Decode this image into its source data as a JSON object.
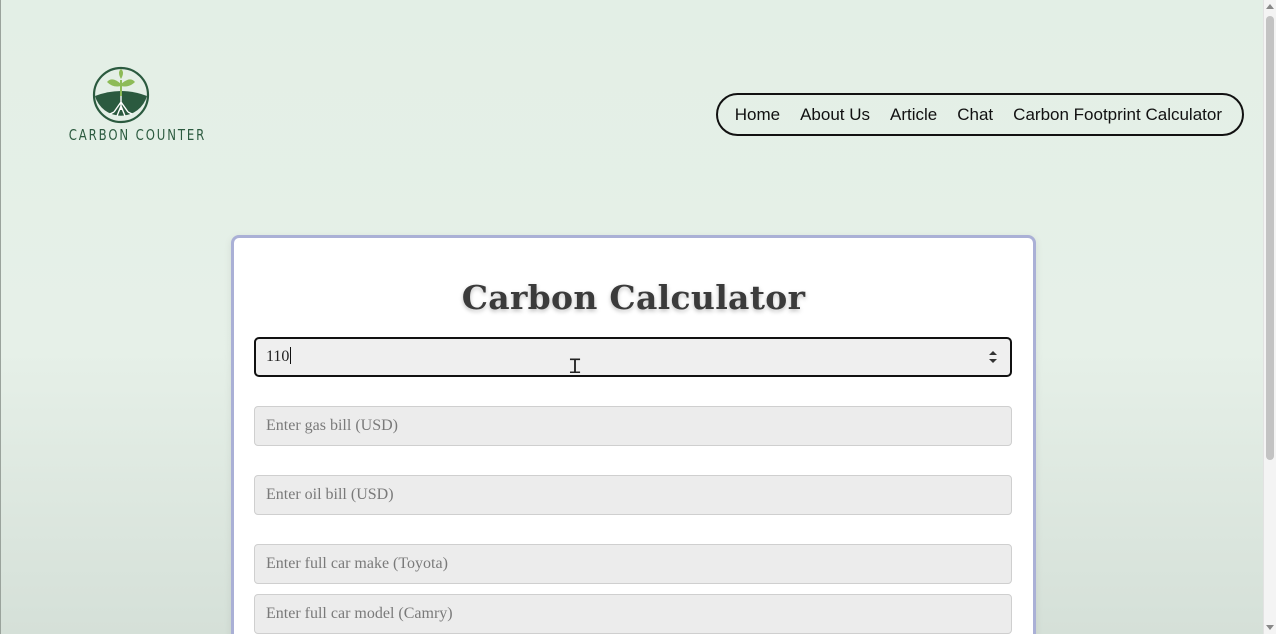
{
  "brand": {
    "logo_text": "CARBON COUNTER",
    "colors": {
      "dark_green": "#2b5a3f",
      "leaf_green": "#8dbb57"
    }
  },
  "nav": {
    "items": [
      "Home",
      "About Us",
      "Article",
      "Chat",
      "Carbon Footprint Calculator"
    ]
  },
  "calculator": {
    "title": "Carbon Calculator",
    "electric_bill_value": "110",
    "gas_bill_placeholder": "Enter gas bill (USD)",
    "oil_bill_placeholder": "Enter oil bill (USD)",
    "car_make_placeholder": "Enter full car make (Toyota)",
    "car_model_placeholder": "Enter full car model (Camry)"
  },
  "colors": {
    "background": "#e3efe6",
    "card_border": "#aab0d6",
    "input_bg": "#ececec"
  }
}
